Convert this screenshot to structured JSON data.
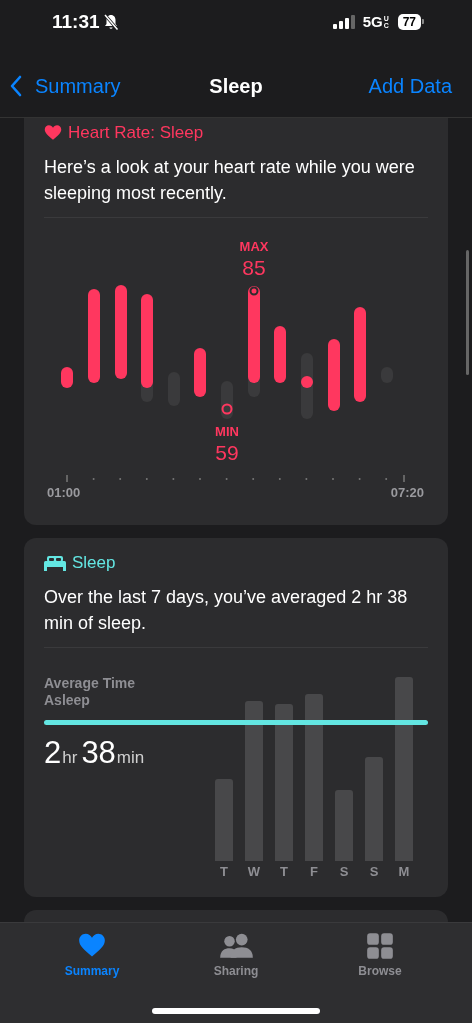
{
  "status_bar": {
    "time": "11:31",
    "network": "5G",
    "network_suffix": "UC",
    "battery": "77"
  },
  "nav_bar": {
    "back": "Summary",
    "title": "Sleep",
    "action": "Add Data"
  },
  "heart_card": {
    "title": "Heart Rate: Sleep",
    "description": "Here’s a look at your heart rate while you were sleeping most recently.",
    "max_label": "MAX",
    "max_value": "85",
    "min_label": "MIN",
    "min_value": "59",
    "x_start": "01:00",
    "x_end": "07:20"
  },
  "sleep_card": {
    "title": "Sleep",
    "description": "Over the last 7 days, you’ve averaged 2 hr 38 min of sleep.",
    "stat_label": "Average Time Asleep",
    "hours": "2",
    "hours_unit": "hr",
    "minutes": "38",
    "minutes_unit": "min",
    "days": [
      "T",
      "W",
      "T",
      "F",
      "S",
      "S",
      "M"
    ]
  },
  "tab_bar": [
    {
      "label": "Summary",
      "kind": "heart",
      "selected": true
    },
    {
      "label": "Sharing",
      "kind": "people",
      "selected": false
    },
    {
      "label": "Browse",
      "kind": "grid",
      "selected": false
    }
  ]
}
